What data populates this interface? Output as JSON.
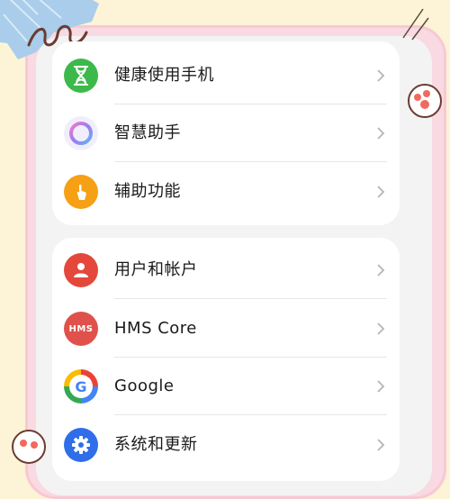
{
  "settings": {
    "group1": [
      {
        "label": "健康使用手机",
        "icon": "hourglass-icon",
        "color": "#3cb94a"
      },
      {
        "label": "智慧助手",
        "icon": "assistant-ring-icon",
        "color": "#9b7cf0"
      },
      {
        "label": "辅助功能",
        "icon": "hand-pointer-icon",
        "color": "#f5a015"
      }
    ],
    "group2": [
      {
        "label": "用户和帐户",
        "icon": "user-icon",
        "color": "#e4483b"
      },
      {
        "label": "HMS Core",
        "icon": "hms-icon",
        "icon_text": "HMS",
        "color": "#e0514b"
      },
      {
        "label": "Google",
        "icon": "google-icon",
        "icon_text": "G",
        "color": "#4285f4"
      },
      {
        "label": "系统和更新",
        "icon": "gear-icon",
        "color": "#2f6ee8"
      }
    ]
  }
}
